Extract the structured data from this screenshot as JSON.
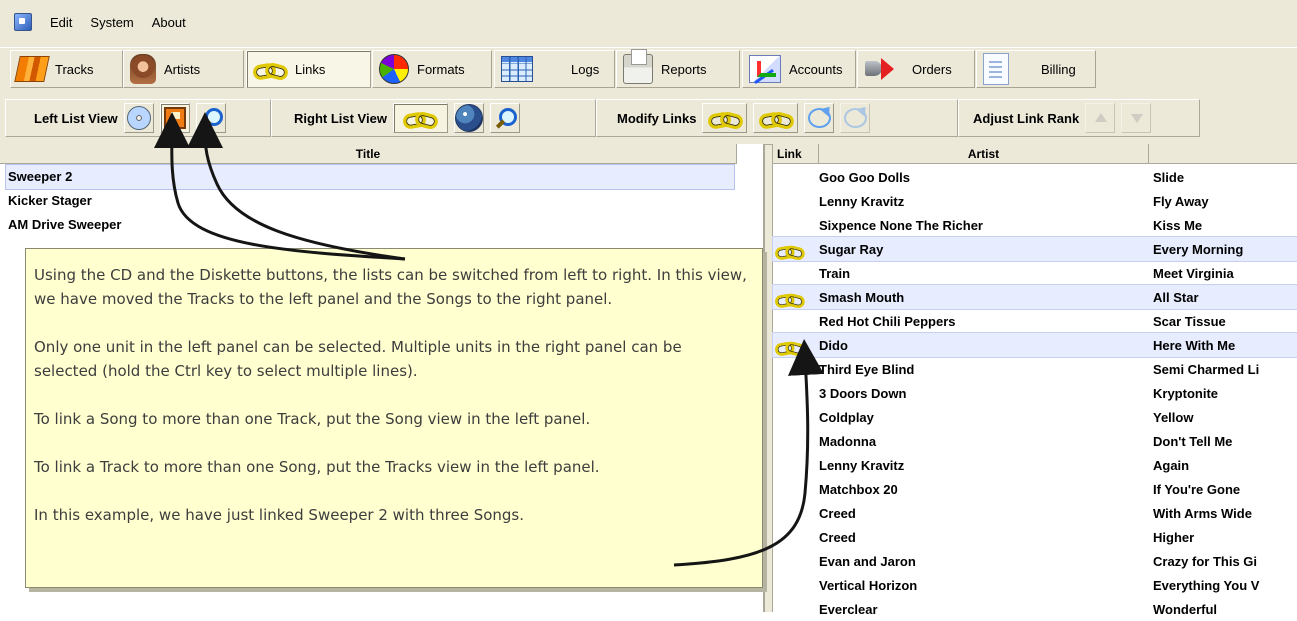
{
  "menu": {
    "items": [
      "Edit",
      "System",
      "About"
    ]
  },
  "toolbar": {
    "tabs": [
      {
        "label": "Tracks",
        "icon": "books-icon"
      },
      {
        "label": "Artists",
        "icon": "face-icon"
      },
      {
        "label": "Links",
        "icon": "link-icon"
      },
      {
        "label": "Formats",
        "icon": "pie-icon"
      },
      {
        "label": "Logs",
        "icon": "calendar-icon"
      },
      {
        "label": "Reports",
        "icon": "printer-icon"
      },
      {
        "label": "Accounts",
        "icon": "accounts-icon"
      },
      {
        "label": "Orders",
        "icon": "megaphone-icon"
      },
      {
        "label": "Billing",
        "icon": "document-icon"
      }
    ]
  },
  "subtoolbar": {
    "left_list_view": "Left List View",
    "right_list_view": "Right List View",
    "modify_links": "Modify Links",
    "adjust_link_rank": "Adjust Link Rank"
  },
  "left_panel": {
    "header": "Title",
    "rows": [
      "Sweeper 2",
      "Kicker Stager",
      "AM Drive Sweeper"
    ]
  },
  "right_panel": {
    "headers": {
      "link": "Link",
      "artist": "Artist"
    },
    "rows": [
      {
        "linked": false,
        "artist": "Goo Goo Dolls",
        "song": "Slide"
      },
      {
        "linked": false,
        "artist": "Lenny Kravitz",
        "song": "Fly Away"
      },
      {
        "linked": false,
        "artist": "Sixpence None The Richer",
        "song": "Kiss Me"
      },
      {
        "linked": true,
        "artist": "Sugar Ray",
        "song": "Every Morning"
      },
      {
        "linked": false,
        "artist": "Train",
        "song": "Meet Virginia"
      },
      {
        "linked": true,
        "artist": "Smash Mouth",
        "song": "All Star"
      },
      {
        "linked": false,
        "artist": "Red Hot Chili Peppers",
        "song": "Scar Tissue"
      },
      {
        "linked": true,
        "artist": "Dido",
        "song": "Here With Me"
      },
      {
        "linked": false,
        "artist": "Third Eye Blind",
        "song": "Semi Charmed Li"
      },
      {
        "linked": false,
        "artist": "3 Doors Down",
        "song": "Kryptonite"
      },
      {
        "linked": false,
        "artist": "Coldplay",
        "song": "Yellow"
      },
      {
        "linked": false,
        "artist": "Madonna",
        "song": "Don't Tell Me"
      },
      {
        "linked": false,
        "artist": "Lenny Kravitz",
        "song": "Again"
      },
      {
        "linked": false,
        "artist": "Matchbox 20",
        "song": "If You're Gone"
      },
      {
        "linked": false,
        "artist": "Creed",
        "song": "With Arms Wide"
      },
      {
        "linked": false,
        "artist": "Creed",
        "song": "Higher"
      },
      {
        "linked": false,
        "artist": "Evan and Jaron",
        "song": "Crazy for This Gi"
      },
      {
        "linked": false,
        "artist": "Vertical Horizon",
        "song": "Everything You V"
      },
      {
        "linked": false,
        "artist": "Everclear",
        "song": "Wonderful"
      }
    ]
  },
  "note": {
    "paragraphs": [
      "Using the CD and the Diskette buttons, the lists can be switched from left to right.  In this view, we have moved the Tracks to the left panel and the Songs to the right panel.",
      "Only one unit in the left panel can be selected.  Multiple units in the right panel can be selected (hold the Ctrl key to select multiple lines).",
      "To link a Song to more than one Track, put the Song view in the left panel.",
      "To link a Track to more than one Song, put the Tracks view in the left panel.",
      "In this example, we have just linked Sweeper 2 with three Songs."
    ]
  }
}
